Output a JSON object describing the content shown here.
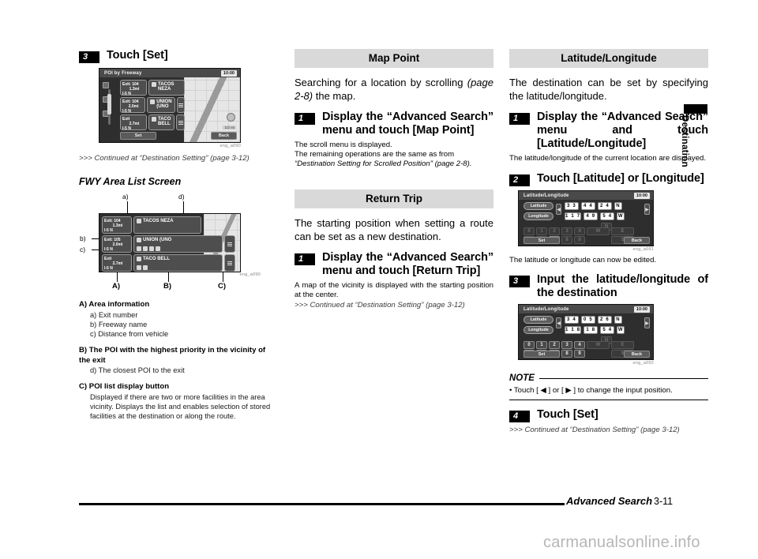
{
  "footer": {
    "section_title": "Advanced Search",
    "page_number": "3-11",
    "watermark": "carmanualsonline.info"
  },
  "edge_tab": {
    "label": "Destination"
  },
  "left_column": {
    "step3": {
      "num": "3",
      "text": "Touch [Set]"
    },
    "figure1": {
      "caption": "eng_a090",
      "screen": {
        "title": "POI by Freeway",
        "clock": "10:00",
        "set_button": "Set",
        "back_button": "Back",
        "scale": "1/2 mi",
        "rows": [
          {
            "exit": "Exit: 104",
            "distance": "1.3mi",
            "road": "I-5 N",
            "poi": "TACOS NEZA",
            "has_list": false
          },
          {
            "exit": "Exit: 104",
            "distance": "2.0mi",
            "road": "I-5 N",
            "poi": "UNION (UNO",
            "has_list": true
          },
          {
            "exit": "Exit",
            "distance": "2.7mi",
            "road": "I-5 N",
            "poi": "TACO BELL",
            "has_list": true
          }
        ]
      }
    },
    "continued1": ">>> Continued at “Destination Setting” (page 3-12)",
    "sub_heading": "FWY Area List Screen",
    "figure2": {
      "caption": "eng_a090",
      "callouts": {
        "a": "a)",
        "b": "b)",
        "c": "c)",
        "d": "d)",
        "A": "A)",
        "B": "B)",
        "C": "C)"
      },
      "screen": {
        "rows": [
          {
            "exit": "Exit: 104",
            "distance": "1.3mi",
            "road": "I-5 N",
            "poi": "TACOS NEZA",
            "has_list": false
          },
          {
            "exit": "Exit: 105",
            "distance": "2.0mi",
            "road": "I-5 N",
            "poi": "UNION (UNO",
            "has_list": true
          },
          {
            "exit": "Exit",
            "distance": "2.7mi",
            "road": "I-5 N",
            "poi": "TACO BELL",
            "has_list": true
          }
        ]
      }
    },
    "legend": [
      {
        "head": "A) Area information",
        "body": "a) Exit number\nb) Freeway name\nc) Distance from vehicle"
      },
      {
        "head": "B) The POI with the highest priority in the vicinity of the exit",
        "body": "d) The closest POI to the exit"
      },
      {
        "head": "C) POI list display button",
        "body": "Displayed if there are two or more facilities in the area vicinity. Displays the list and enables selection of stored facilities at the destination or along the route."
      }
    ]
  },
  "mid_column": {
    "map_point": {
      "banner": "Map Point",
      "intro_plain_1": "Searching for a location by scrolling ",
      "intro_italic": "(page 2-8)",
      "intro_plain_2": " the map.",
      "step1": {
        "num": "1",
        "text": "Display the “Advanced Search” menu and touch [Map Point]"
      },
      "note_line1": "The scroll menu is displayed.",
      "note_line2": "The remaining operations are the same as from",
      "note_line3": "“Destination Setting for Scrolled Position” (page 2-8)."
    },
    "return_trip": {
      "banner": "Return Trip",
      "intro": "The starting position when setting a route can be set as a new destination.",
      "step1": {
        "num": "1",
        "text": "Display the “Advanced Search” menu and touch [Return Trip]"
      },
      "note_line1": "A map of the vicinity is displayed with the starting position at the center.",
      "continued": ">>> Continued at “Destination Setting” (page 3-12)"
    }
  },
  "right_column": {
    "lat_long": {
      "banner": "Latitude/Longitude",
      "intro": "The destination can be set by specifying the latitude/longitude.",
      "step1": {
        "num": "1",
        "text": "Display the “Advanced Search” menu and touch [Latitude/Longitude]"
      },
      "step1_note": "The latitude/longitude of the current location are displayed.",
      "step2": {
        "num": "2",
        "text": "Touch [Latitude] or [Longitude]"
      },
      "figure1": {
        "caption": "eng_a091",
        "screen": {
          "title": "Latitude/Longitude",
          "clock": "10:00",
          "lat_label": "Latitude",
          "lon_label": "Longitude",
          "lat_values": [
            "3 3",
            "4 4",
            "2 4",
            "N"
          ],
          "lon_values": [
            "1 1 7",
            "4 9",
            "5 4",
            "W"
          ],
          "set_button": "Set",
          "back_button": "Back",
          "keys_row1": [
            "0",
            "1",
            "2",
            "3",
            "4"
          ],
          "keys_row2": [
            "5",
            "6",
            "7",
            "8",
            "9"
          ],
          "dir_keys": [
            "N",
            "W",
            "E",
            "S"
          ],
          "active_key": "7"
        }
      },
      "figure1_note": "The latitude or longitude can now be edited.",
      "step3": {
        "num": "3",
        "text": "Input the latitude/longitude of the destination"
      },
      "figure2": {
        "caption": "eng_a092",
        "screen": {
          "title": "Latitude/Longitude",
          "clock": "10:00",
          "lat_label": "Latitude",
          "lon_label": "Longitude",
          "lat_values": [
            "3 4",
            "0 5",
            "2 6",
            "N"
          ],
          "lon_values": [
            "1 1 8",
            "1 8",
            "5 4",
            "W"
          ],
          "set_button": "Set",
          "back_button": "Back",
          "keys_row1": [
            "0",
            "1",
            "2",
            "3",
            "4"
          ],
          "keys_row2": [
            "5",
            "6",
            "7",
            "8",
            "9"
          ],
          "dir_keys": [
            "N",
            "W",
            "E",
            "S"
          ],
          "active_key": "7"
        }
      },
      "note_label": "NOTE",
      "note_text": "• Touch [ ◀ ] or [ ▶ ] to change the input position.",
      "step4": {
        "num": "4",
        "text": "Touch [Set]"
      },
      "continued": ">>> Continued at “Destination Setting” (page 3-12)"
    }
  }
}
